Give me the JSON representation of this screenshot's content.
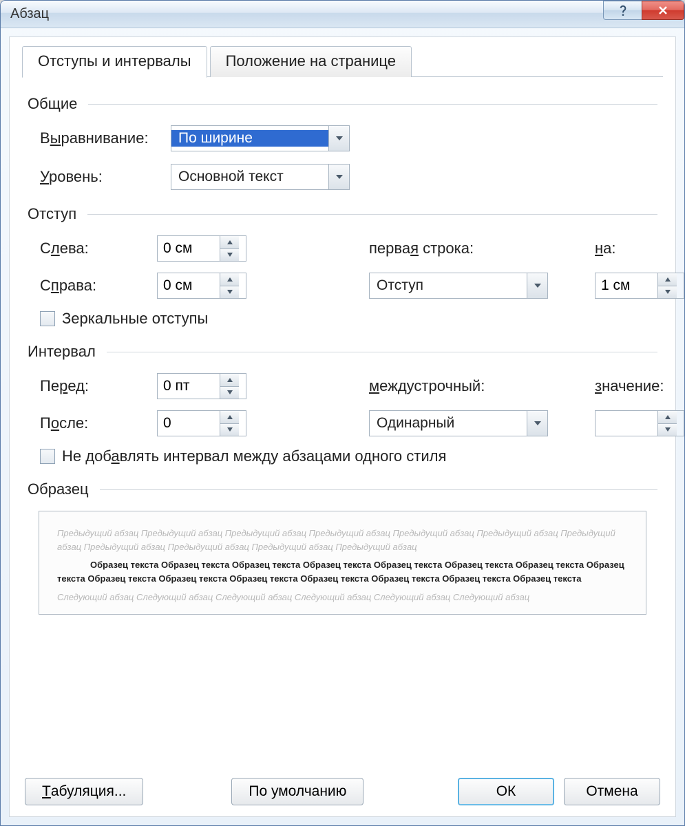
{
  "title": "Абзац",
  "tabs": {
    "active": "Отступы и интервалы",
    "other": "Положение на странице"
  },
  "groups": {
    "general": {
      "title": "Общие",
      "alignment_label": "Выравнивание:",
      "alignment_value": "По ширине",
      "level_label": "Уровень:",
      "level_value": "Основной текст"
    },
    "indent": {
      "title": "Отступ",
      "left_label": "Слева:",
      "left_value": "0 см",
      "right_label": "Справа:",
      "right_value": "0 см",
      "firstline_label": "первая строка:",
      "firstline_value": "Отступ",
      "by_label": "на:",
      "by_value": "1 см",
      "mirror_label": "Зеркальные отступы",
      "mirror_checked": false
    },
    "spacing": {
      "title": "Интервал",
      "before_label": "Перед:",
      "before_value": "0 пт",
      "after_label": "После:",
      "after_value": "0",
      "line_label": "междустрочный:",
      "line_value": "Одинарный",
      "at_label": "значение:",
      "at_value": "",
      "noaddspace_label": "Не добавлять интервал между абзацами одного стиля",
      "noaddspace_checked": false
    },
    "preview": {
      "title": "Образец",
      "prev_text": "Предыдущий абзац Предыдущий абзац Предыдущий абзац Предыдущий абзац Предыдущий абзац Предыдущий абзац Предыдущий абзац Предыдущий абзац Предыдущий абзац Предыдущий абзац Предыдущий абзац",
      "cur_text": "Образец текста Образец текста Образец текста Образец текста Образец текста Образец текста Образец текста Образец текста Образец текста Образец текста Образец текста Образец текста Образец текста Образец текста Образец текста",
      "next_text": "Следующий абзац Следующий абзац Следующий абзац Следующий абзац Следующий абзац Следующий абзац"
    }
  },
  "footer": {
    "tabs_btn": "Табуляция...",
    "default_btn": "По умолчанию",
    "ok_btn": "ОК",
    "cancel_btn": "Отмена"
  }
}
